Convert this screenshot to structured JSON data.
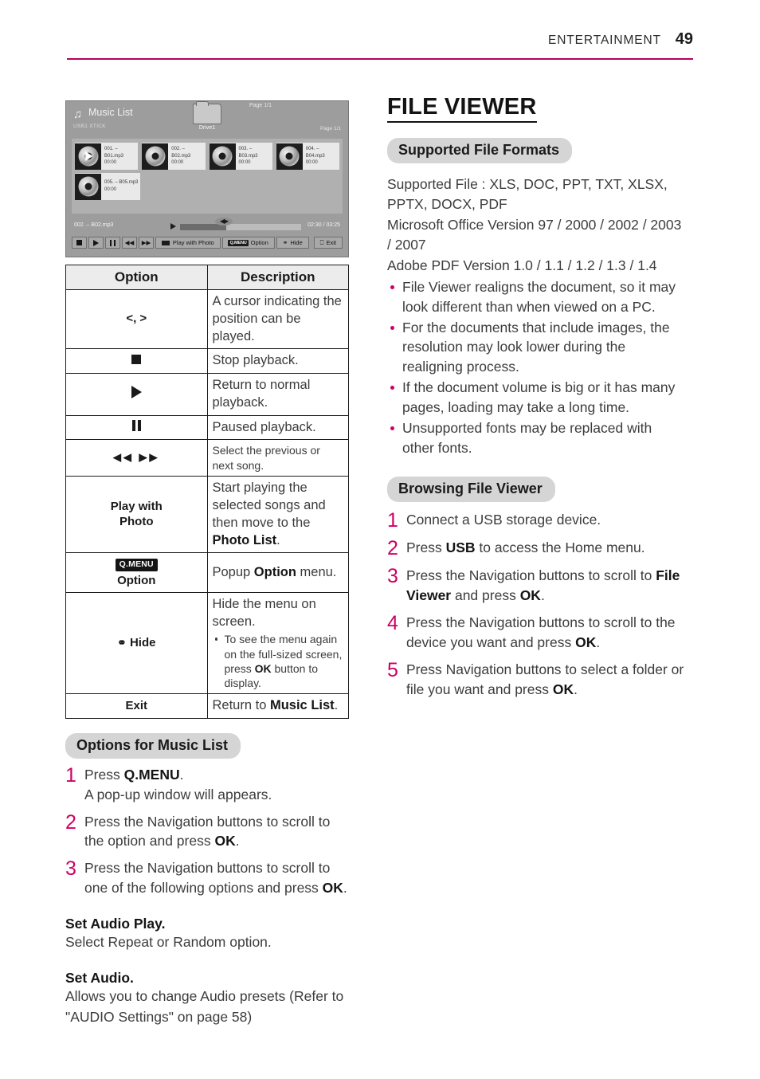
{
  "header": {
    "section": "ENTERTAINMENT",
    "page_number": "49",
    "rule_color": "#b5005e"
  },
  "tv_mockup": {
    "title": "Music List",
    "note_icon": "music-note-icon",
    "device_label": "USB1 XTICK",
    "page_top": "Page 1/1",
    "page_right": "Page 1/1",
    "folder": {
      "icon": "folder-icon",
      "label": "Drive1"
    },
    "items": [
      {
        "name": "001. – B01.mp3",
        "time": "00:00",
        "playing": true
      },
      {
        "name": "002. – B02.mp3",
        "time": "00:00",
        "playing": false
      },
      {
        "name": "003. – B03.mp3",
        "time": "00:00",
        "playing": false
      },
      {
        "name": "004. – B04.mp3",
        "time": "00:00",
        "playing": false
      },
      {
        "name": "005. – B05.mp3",
        "time": "00:00",
        "playing": false
      }
    ],
    "now_playing": {
      "track": "002. – B02.mp3",
      "elapsed_total": "02:30 / 03:25",
      "progress_percent": 38
    },
    "controls": [
      {
        "name": "stop",
        "label": ""
      },
      {
        "name": "play",
        "label": ""
      },
      {
        "name": "pause",
        "label": ""
      },
      {
        "name": "rewind",
        "label": ""
      },
      {
        "name": "fast-forward",
        "label": ""
      },
      {
        "name": "play-with-photo",
        "label": "Play with Photo"
      },
      {
        "name": "option",
        "label": "Option",
        "badge": "Q.MENU"
      },
      {
        "name": "hide",
        "label": "Hide"
      },
      {
        "name": "exit",
        "label": "Exit"
      }
    ]
  },
  "options_table": {
    "headers": {
      "option": "Option",
      "description": "Description"
    },
    "rows": [
      {
        "key": "<, >",
        "key_kind": "text",
        "desc": "A cursor indicating the position can be played."
      },
      {
        "key": "",
        "key_kind": "stop",
        "desc": "Stop playback."
      },
      {
        "key": "",
        "key_kind": "play",
        "desc": "Return to normal playback."
      },
      {
        "key": "",
        "key_kind": "pause",
        "desc": "Paused playback."
      },
      {
        "key": "◀◀ ▶▶",
        "key_kind": "prevnext",
        "desc": "Select the previous or next song.",
        "small": true
      },
      {
        "key": "Play with Photo",
        "key_kind": "twoline",
        "key_line1": "Play with",
        "key_line2": "Photo",
        "desc_html": "Start playing the selected songs and then move to the <b>Photo List</b>."
      },
      {
        "key": "Q.MENU Option",
        "key_kind": "qmenu",
        "key_badge": "Q.MENU",
        "key_line2": "Option",
        "desc_html": "Popup <b>Option</b> menu."
      },
      {
        "key": "Hide",
        "key_kind": "hide",
        "desc": "Hide the menu on screen.",
        "subbullets": [
          "To see the menu again on the full-sized screen, press OK button to display."
        ]
      },
      {
        "key": "Exit",
        "key_kind": "text",
        "desc_html": "Return to <b>Music List</b>."
      }
    ]
  },
  "options_for_music_list": {
    "heading": "Options for Music List",
    "steps": [
      {
        "num": "1",
        "text": "Press Q.MENU. A pop-up window will appears."
      },
      {
        "num": "2",
        "text": "Press the Navigation buttons to scroll to the option and press OK."
      },
      {
        "num": "3",
        "text": "Press the Navigation buttons to scroll to one of the following options and press OK."
      }
    ],
    "sections": [
      {
        "title": "Set Audio Play.",
        "body": "Select Repeat or Random option."
      },
      {
        "title": "Set Audio.",
        "body": "Allows you to change Audio presets (Refer to \"AUDIO Settings\" on page 58)"
      }
    ]
  },
  "file_viewer": {
    "heading": "FILE VIEWER",
    "supported": {
      "pill": "Supported File Formats",
      "lines": [
        "Supported File : XLS, DOC, PPT, TXT, XLSX, PPTX, DOCX, PDF",
        "Microsoft Office Version 97 / 2000 / 2002 / 2003 / 2007",
        "Adobe PDF Version 1.0 / 1.1 / 1.2 / 1.3 / 1.4"
      ],
      "bullets": [
        "File Viewer realigns the document, so it may look different than when viewed on a PC.",
        "For the documents that include images, the resolution may look lower during the realigning process.",
        "If the document volume is big or it has many pages, loading may take a long time.",
        "Unsupported fonts may be replaced with other fonts."
      ]
    },
    "browsing": {
      "pill": "Browsing File Viewer",
      "steps": [
        {
          "num": "1",
          "text": "Connect a USB storage device."
        },
        {
          "num": "2",
          "text": "Press USB to access the Home menu."
        },
        {
          "num": "3",
          "text": "Press the Navigation buttons to scroll to File Viewer and press OK."
        },
        {
          "num": "4",
          "text": "Press the Navigation buttons to scroll to the device you want and press OK."
        },
        {
          "num": "5",
          "text": "Press Navigation buttons to select a folder or file you want and press OK."
        }
      ]
    }
  }
}
